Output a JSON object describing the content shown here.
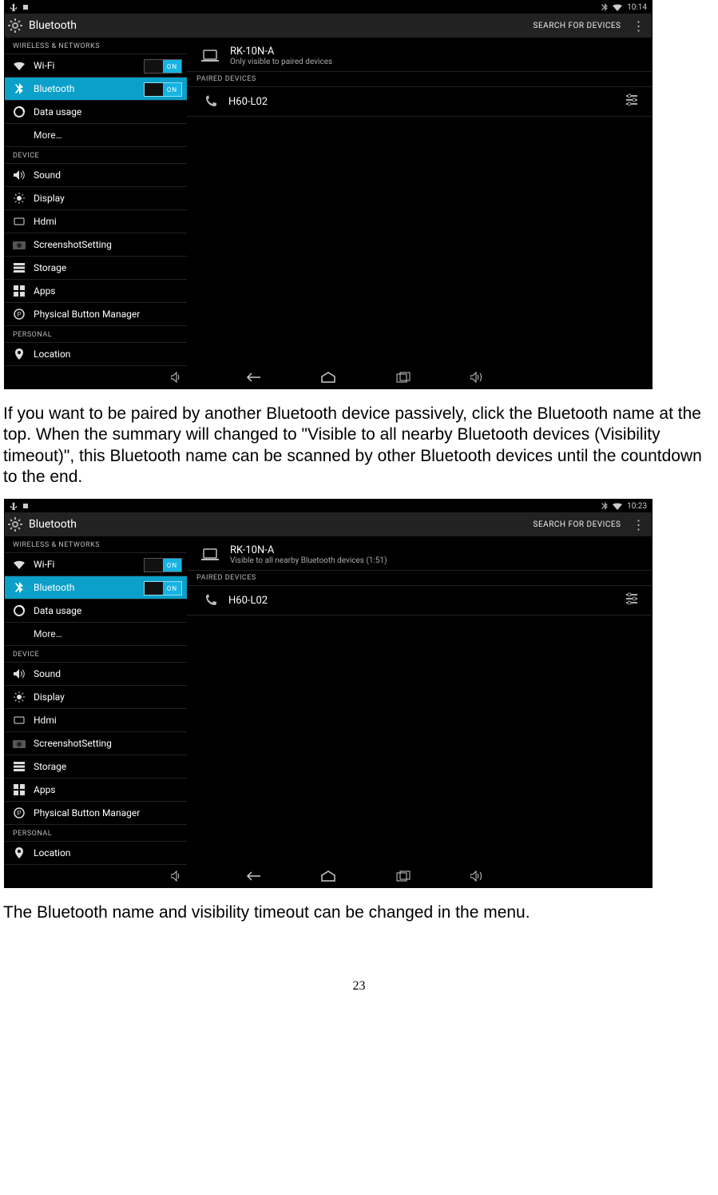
{
  "doc": {
    "para1": "If you want to be paired by another Bluetooth device passively, click the Bluetooth name at the top. When the summary will changed to \"Visible to all nearby Bluetooth devices (Visibility timeout)\", this Bluetooth name can be scanned by other Bluetooth devices until the countdown to the end.",
    "para2": "The Bluetooth name and visibility timeout can be changed in the menu.",
    "page_number": "23"
  },
  "shot1": {
    "status": {
      "time": "10:14"
    },
    "actionbar": {
      "title": "Bluetooth",
      "search": "SEARCH FOR DEVICES"
    },
    "sections": {
      "wireless": "WIRELESS & NETWORKS",
      "device": "DEVICE",
      "personal": "PERSONAL"
    },
    "nav": {
      "wifi": "Wi-Fi",
      "bluetooth": "Bluetooth",
      "data_usage": "Data usage",
      "more": "More…",
      "sound": "Sound",
      "display": "Display",
      "hdmi": "Hdmi",
      "screenshot": "ScreenshotSetting",
      "storage": "Storage",
      "apps": "Apps",
      "pbm": "Physical Button Manager",
      "location": "Location",
      "toggle_on": "ON"
    },
    "device_header": {
      "name": "RK-10N-A",
      "sub": "Only visible to paired devices"
    },
    "paired": {
      "header": "PAIRED DEVICES",
      "item1": "H60-L02"
    }
  },
  "shot2": {
    "status": {
      "time": "10:23"
    },
    "actionbar": {
      "title": "Bluetooth",
      "search": "SEARCH FOR DEVICES"
    },
    "sections": {
      "wireless": "WIRELESS & NETWORKS",
      "device": "DEVICE",
      "personal": "PERSONAL"
    },
    "nav": {
      "wifi": "Wi-Fi",
      "bluetooth": "Bluetooth",
      "data_usage": "Data usage",
      "more": "More…",
      "sound": "Sound",
      "display": "Display",
      "hdmi": "Hdmi",
      "screenshot": "ScreenshotSetting",
      "storage": "Storage",
      "apps": "Apps",
      "pbm": "Physical Button Manager",
      "location": "Location",
      "toggle_on": "ON"
    },
    "device_header": {
      "name": "RK-10N-A",
      "sub": "Visible to all nearby Bluetooth devices (1:51)"
    },
    "paired": {
      "header": "PAIRED DEVICES",
      "item1": "H60-L02"
    }
  }
}
